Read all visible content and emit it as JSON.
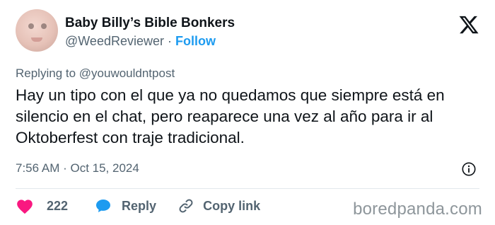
{
  "user": {
    "display_name": "Baby Billy’s Bible Bonkers",
    "handle": "@WeedReviewer",
    "separator": "·",
    "follow_label": "Follow"
  },
  "tweet": {
    "replying_to": "Replying to @youwouldntpost",
    "text": "Hay un tipo con el que ya no quedamos que siempre está en silencio en el chat, pero reaparece una vez al año para ir al Oktoberfest con traje tradicional.",
    "timestamp": "7:56 AM · Oct 15, 2024"
  },
  "actions": {
    "like_count": "222",
    "reply_label": "Reply",
    "copy_link_label": "Copy link"
  },
  "icons": {
    "brand": "x-logo-icon",
    "info": "info-icon",
    "like": "heart-icon",
    "reply": "reply-bubble-icon",
    "copy_link": "link-icon"
  },
  "colors": {
    "follow": "#1d9bf0",
    "heart": "#f91880",
    "reply_bubble": "#1d9bf0",
    "secondary_text": "#536471",
    "watermark": "#8e969b"
  },
  "watermark": "boredpanda.com"
}
